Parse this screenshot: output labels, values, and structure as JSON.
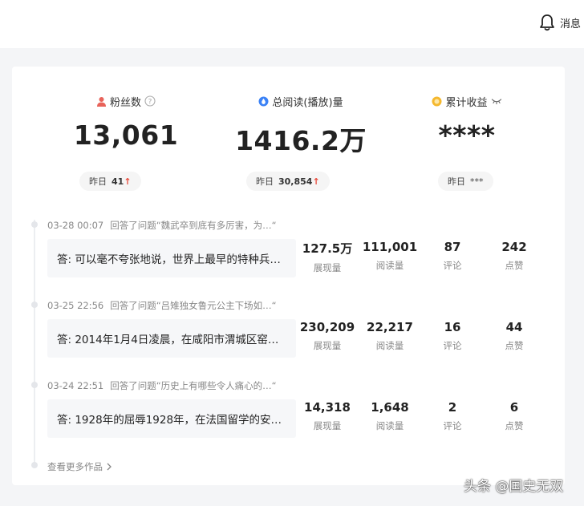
{
  "header": {
    "messages_label": "消息"
  },
  "stats": [
    {
      "label": "粉丝数",
      "value": "13,061",
      "yesterday_label": "昨日",
      "yesterday_value": "41",
      "trend": "↑",
      "icon": "user-icon",
      "color": "#e8635a"
    },
    {
      "label": "总阅读(播放)量",
      "value": "1416.2万",
      "yesterday_label": "昨日",
      "yesterday_value": "30,854",
      "trend": "↑",
      "icon": "drop-icon",
      "color": "#3b82f6"
    },
    {
      "label": "累计收益",
      "value": "****",
      "yesterday_label": "昨日",
      "yesterday_value": "***",
      "icon": "coin-icon",
      "color": "#f5b82e"
    }
  ],
  "works": [
    {
      "time": "03-28 00:07",
      "question": "回答了问题“魏武卒到底有多厉害，为…“",
      "answer": "答: 可以毫不夸张地说，世界上最早的特种兵…",
      "metrics": [
        {
          "value": "127.5万",
          "label": "展现量"
        },
        {
          "value": "111,001",
          "label": "阅读量"
        },
        {
          "value": "87",
          "label": "评论"
        },
        {
          "value": "242",
          "label": "点赞"
        }
      ]
    },
    {
      "time": "03-25 22:56",
      "question": "回答了问题“吕雉独女鲁元公主下场如…“",
      "answer": "答: 2014年1月4日凌晨，在咸阳市渭城区窑…",
      "metrics": [
        {
          "value": "230,209",
          "label": "展现量"
        },
        {
          "value": "22,217",
          "label": "阅读量"
        },
        {
          "value": "16",
          "label": "评论"
        },
        {
          "value": "44",
          "label": "点赞"
        }
      ]
    },
    {
      "time": "03-24 22:51",
      "question": "回答了问题“历史上有哪些令人痛心的…“",
      "answer": "答: 1928年的屈辱1928年，在法国留学的安…",
      "metrics": [
        {
          "value": "14,318",
          "label": "展现量"
        },
        {
          "value": "1,648",
          "label": "阅读量"
        },
        {
          "value": "2",
          "label": "评论"
        },
        {
          "value": "6",
          "label": "点赞"
        }
      ]
    }
  ],
  "more_link": "查看更多作品",
  "watermark": "头条 @国史无双"
}
